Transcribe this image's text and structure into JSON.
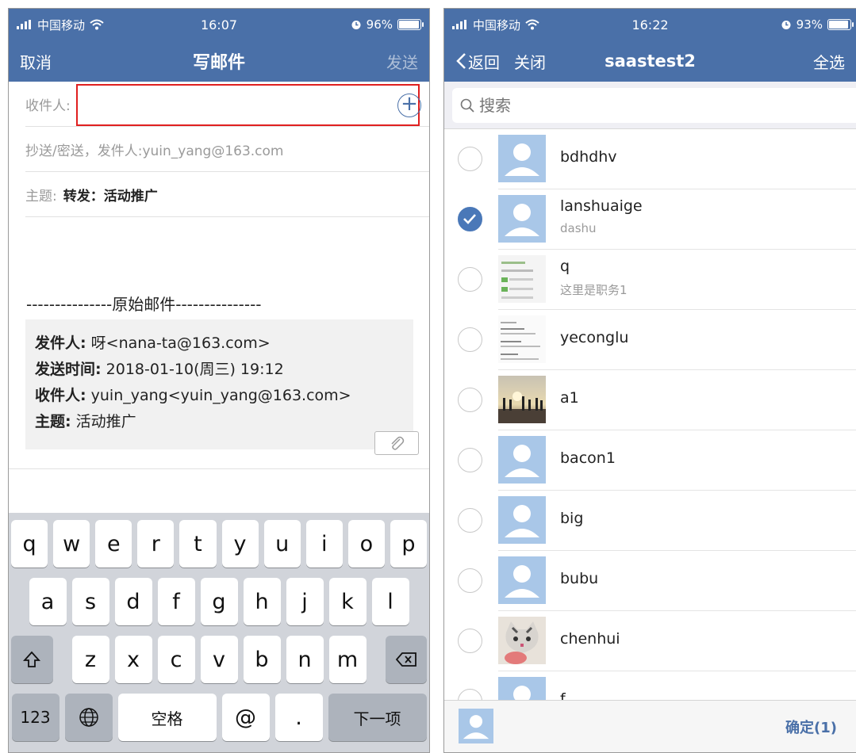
{
  "left": {
    "status": {
      "carrier": "中国移动",
      "time": "16:07",
      "battery": "96%",
      "battery_level": 0.96
    },
    "nav": {
      "cancel": "取消",
      "title": "写邮件",
      "send": "发送"
    },
    "to_label": "收件人:",
    "cc_label": "抄送/密送，发件人:yuin_yang@163.com",
    "subject_label": "主题:",
    "subject_value": "转发：活动推广",
    "orig_separator": "---------------原始邮件---------------",
    "quote": {
      "from_label": "发件人:",
      "from_value": " 呀<nana-ta@163.com>",
      "time_label": "发送时间:",
      "time_value": " 2018-01-10(周三) 19:12",
      "to_label": "收件人:",
      "to_value": " yuin_yang<yuin_yang@163.com>",
      "subject_label": "主题:",
      "subject_value": " 活动推广"
    },
    "keyboard": {
      "row1": [
        "q",
        "w",
        "e",
        "r",
        "t",
        "y",
        "u",
        "i",
        "o",
        "p"
      ],
      "row2": [
        "a",
        "s",
        "d",
        "f",
        "g",
        "h",
        "j",
        "k",
        "l"
      ],
      "row3": [
        "z",
        "x",
        "c",
        "v",
        "b",
        "n",
        "m"
      ],
      "num_key": "123",
      "space_key": "空格",
      "at_key": "@",
      "dot_key": ".",
      "next_key": "下一项"
    }
  },
  "right": {
    "status": {
      "carrier": "中国移动",
      "time": "16:22",
      "battery": "93%",
      "battery_level": 0.93
    },
    "nav": {
      "back": "返回",
      "close": "关闭",
      "title": "saastest2",
      "select_all": "全选"
    },
    "search_placeholder": "搜索",
    "contacts": [
      {
        "name": "bdhdhv",
        "sub": "",
        "checked": false,
        "avatar": "default"
      },
      {
        "name": "lanshuaige",
        "sub": "dashu",
        "checked": true,
        "avatar": "default"
      },
      {
        "name": "q",
        "sub": "这里是职务1",
        "checked": false,
        "avatar": "screenshot"
      },
      {
        "name": "yeconglu",
        "sub": "",
        "checked": false,
        "avatar": "document"
      },
      {
        "name": "a1",
        "sub": "",
        "checked": false,
        "avatar": "sunset-photo"
      },
      {
        "name": "bacon1",
        "sub": "",
        "checked": false,
        "avatar": "default"
      },
      {
        "name": "big",
        "sub": "",
        "checked": false,
        "avatar": "default"
      },
      {
        "name": "bubu",
        "sub": "",
        "checked": false,
        "avatar": "default"
      },
      {
        "name": "chenhui",
        "sub": "",
        "checked": false,
        "avatar": "cat-photo"
      },
      {
        "name": "f",
        "sub": "",
        "checked": false,
        "avatar": "default"
      }
    ],
    "confirm": "确定(1)"
  },
  "colors": {
    "nav_bg": "#4a70a8",
    "avatar_bg": "#a9c7e8",
    "highlight": "#e02020"
  }
}
